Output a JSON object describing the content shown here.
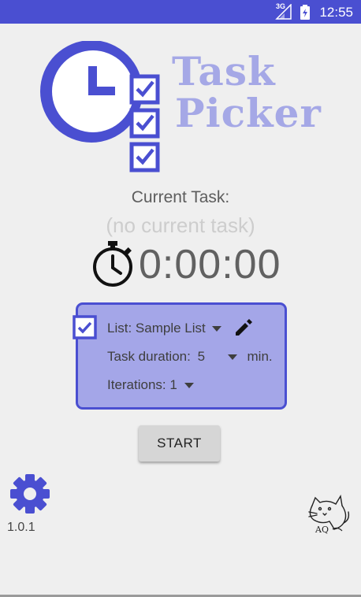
{
  "status_bar": {
    "time": "12:55",
    "network": "3G"
  },
  "logo": {
    "line1": "Task",
    "line2": "Picker"
  },
  "current": {
    "label": "Current Task:",
    "value": "(no current task)"
  },
  "timer": {
    "display": "0:00:00"
  },
  "settings_panel": {
    "list_label": "List:",
    "list_value": "Sample List",
    "duration_label": "Task duration:",
    "duration_value": "5",
    "duration_unit": "min.",
    "iterations_label": "Iterations:",
    "iterations_value": "1"
  },
  "actions": {
    "start_label": "START"
  },
  "footer": {
    "version": "1.0.1",
    "signature": "AQ"
  },
  "colors": {
    "accent": "#4a4fd1",
    "panel": "#a4a6e8",
    "logo_text": "#a5a8e6"
  }
}
